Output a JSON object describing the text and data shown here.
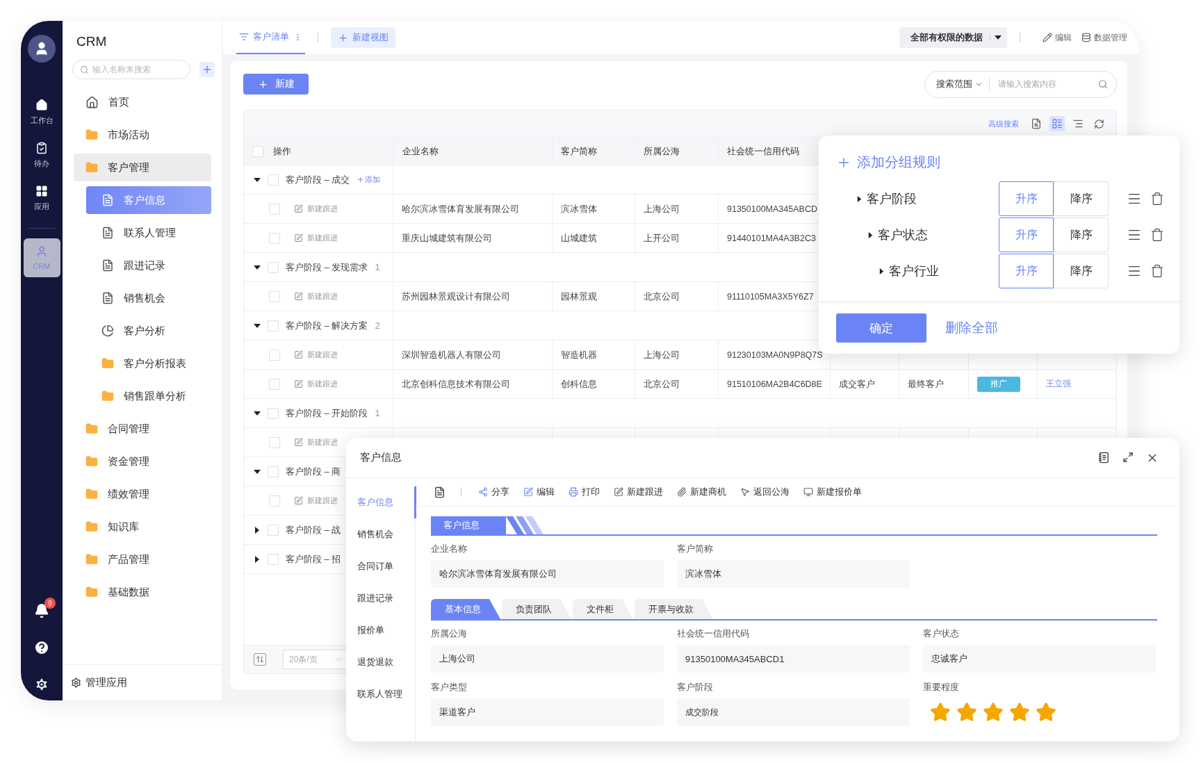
{
  "rail": {
    "items": [
      {
        "kind": "home",
        "label": "工作台",
        "selected": false
      },
      {
        "kind": "todo",
        "label": "待办",
        "selected": false
      },
      {
        "kind": "apps",
        "label": "应用",
        "selected": false
      },
      {
        "kind": "crm",
        "label": "CRM",
        "selected": true
      }
    ],
    "notifications": "9"
  },
  "sidebar": {
    "title": "CRM",
    "search_placeholder": "输入名称来搜索",
    "items": [
      {
        "kind": "home",
        "label": "首页",
        "selected": false
      },
      {
        "kind": "folder",
        "label": "市场活动",
        "selected": false
      },
      {
        "kind": "folder",
        "label": "客户管理",
        "selected": false,
        "expanded": true,
        "children": [
          {
            "kind": "doc",
            "label": "客户信息",
            "selected": true
          },
          {
            "kind": "doc",
            "label": "联系人管理",
            "selected": false
          },
          {
            "kind": "doc",
            "label": "跟进记录",
            "selected": false
          },
          {
            "kind": "doc",
            "label": "销售机会",
            "selected": false
          },
          {
            "kind": "pie",
            "label": "客户分析",
            "selected": false
          },
          {
            "kind": "folder",
            "label": "客户分析报表",
            "selected": false
          },
          {
            "kind": "folder",
            "label": "销售跟单分析",
            "selected": false
          }
        ]
      },
      {
        "kind": "folder",
        "label": "合同管理",
        "selected": false
      },
      {
        "kind": "folder",
        "label": "资金管理",
        "selected": false
      },
      {
        "kind": "folder",
        "label": "绩效管理",
        "selected": false
      },
      {
        "kind": "folder",
        "label": "知识库",
        "selected": false
      },
      {
        "kind": "folder",
        "label": "产品管理",
        "selected": false
      },
      {
        "kind": "folder",
        "label": "基础数据",
        "selected": false
      }
    ],
    "footer": "管理应用"
  },
  "view_tabs": [
    {
      "label": "客户清单",
      "selected": true
    }
  ],
  "new_view": "新建视图",
  "scope": "全部有权限的数据",
  "top_actions": [
    {
      "kind": "edit",
      "label": "编辑"
    },
    {
      "kind": "data",
      "label": "数据管理"
    }
  ],
  "new_button": "新建",
  "search": {
    "scope": "搜索范围",
    "placeholder": "请输入搜索内容"
  },
  "advanced_search": "高级搜索",
  "table_tools": [
    {
      "kind": "export",
      "selected": false
    },
    {
      "kind": "group",
      "selected": true
    },
    {
      "kind": "columns",
      "selected": false
    },
    {
      "kind": "refresh",
      "selected": false
    }
  ],
  "table": {
    "all_checked": false,
    "columns": [
      "操作",
      "企业名称",
      "客户简称",
      "所属公海",
      "社会统一信用代码"
    ],
    "rows": [
      {
        "kind": "group",
        "label": "客户阶段 – 成交",
        "expanded": true,
        "checked": false,
        "add_label": "添加"
      },
      {
        "kind": "record",
        "checked": false,
        "action": "新建跟进",
        "cells": [
          "哈尔滨冰雪体育发展有限公司",
          "滨冰雪体",
          "上海公司",
          "91350100MA345ABCD"
        ]
      },
      {
        "kind": "record",
        "checked": false,
        "action": "新建跟进",
        "cells": [
          "重庆山城建筑有限公司",
          "山城建筑",
          "上开公司",
          "91440101MA4A3B2C3"
        ]
      },
      {
        "kind": "group",
        "label": "客户阶段 – 发现需求",
        "count": "1",
        "expanded": true,
        "checked": false
      },
      {
        "kind": "record",
        "checked": false,
        "action": "新建跟进",
        "cells": [
          "苏州园林景观设计有限公司",
          "园林景观",
          "北京公司",
          "91110105MA3X5Y6Z7"
        ]
      },
      {
        "kind": "group",
        "label": "客户阶段 – 解决方案",
        "count": "2",
        "expanded": true,
        "checked": false
      },
      {
        "kind": "record",
        "checked": false,
        "action": "新建跟进",
        "cells": [
          "深圳智造机器人有限公司",
          "智造机器",
          "上海公司",
          "91230103MA0N9P8Q7S"
        ]
      },
      {
        "kind": "record",
        "checked": false,
        "action": "新建跟进",
        "cells": [
          "北京创科信息技术有限公司",
          "创科信息",
          "北京公司",
          "91510106MA2B4C6D8E",
          "成交客户",
          "最终客户"
        ],
        "tag": {
          "label": "推广",
          "color": "#4cb8e0"
        },
        "owner": "王立强"
      },
      {
        "kind": "group",
        "label": "客户阶段 – 开始阶段",
        "count": "1",
        "expanded": true,
        "checked": false
      },
      {
        "kind": "record",
        "checked": false,
        "action": "新建跟进"
      },
      {
        "kind": "group",
        "label": "客户阶段 – 商",
        "expanded": true,
        "checked": false
      },
      {
        "kind": "record",
        "checked": false,
        "action": "新建跟进"
      },
      {
        "kind": "group",
        "label": "客户阶段 – 战",
        "expanded": false,
        "checked": false
      },
      {
        "kind": "group",
        "label": "客户阶段 – 招",
        "expanded": false,
        "checked": false
      }
    ]
  },
  "page_size": "20条/页",
  "group_popup": {
    "add_rule": "添加分组规则",
    "rules": [
      {
        "field": "客户阶段",
        "order": [
          {
            "label": "升序",
            "selected": true
          },
          {
            "label": "降序",
            "selected": false
          }
        ],
        "children": [
          {
            "field": "客户状态",
            "order": [
              {
                "label": "升序",
                "selected": true
              },
              {
                "label": "降序",
                "selected": false
              }
            ],
            "children": [
              {
                "field": "客户行业",
                "order": [
                  {
                    "label": "升序",
                    "selected": true
                  },
                  {
                    "label": "降序",
                    "selected": false
                  }
                ]
              }
            ]
          }
        ]
      }
    ],
    "confirm": "确定",
    "delete_all": "删除全部"
  },
  "dialog": {
    "title": "客户信息",
    "nav": [
      {
        "label": "客户信息",
        "selected": true
      },
      {
        "label": "销售机会",
        "selected": false
      },
      {
        "label": "合同订单",
        "selected": false
      },
      {
        "label": "跟进记录",
        "selected": false
      },
      {
        "label": "报价单",
        "selected": false
      },
      {
        "label": "退货退款",
        "selected": false
      },
      {
        "label": "联系人管理",
        "selected": false
      }
    ],
    "actions": [
      {
        "kind": "share",
        "label": "分享"
      },
      {
        "kind": "edit",
        "label": "编辑"
      },
      {
        "kind": "print",
        "label": "打印"
      },
      {
        "kind": "follow",
        "label": "新建跟进"
      },
      {
        "kind": "attach",
        "label": "新建商机"
      },
      {
        "kind": "return",
        "label": "返回公海"
      },
      {
        "kind": "quote",
        "label": "新建报价单"
      }
    ],
    "section": "客户信息",
    "top_fields": [
      {
        "kind": "text",
        "label": "企业名称",
        "value": "哈尔滨冰雪体育发展有限公司"
      },
      {
        "kind": "text",
        "label": "客户简称",
        "value": "滨冰雪体"
      }
    ],
    "tabs": [
      {
        "label": "基本信息",
        "selected": true
      },
      {
        "label": "负责团队",
        "selected": false
      },
      {
        "label": "文件柜",
        "selected": false
      },
      {
        "label": "开票与收款",
        "selected": false
      }
    ],
    "fields": [
      {
        "kind": "text",
        "label": "所属公海",
        "value": "上海公司"
      },
      {
        "kind": "text",
        "label": "社会统一信用代码",
        "value": "91350100MA345ABCD1"
      },
      {
        "kind": "text",
        "label": "客户状态",
        "value": "忠诚客户"
      },
      {
        "kind": "text",
        "label": "客户类型",
        "value": "渠道客户"
      },
      {
        "kind": "small",
        "label": "客户阶段",
        "value": "成交阶段"
      },
      {
        "kind": "rating",
        "label": "重要程度",
        "stars": 5
      }
    ]
  }
}
